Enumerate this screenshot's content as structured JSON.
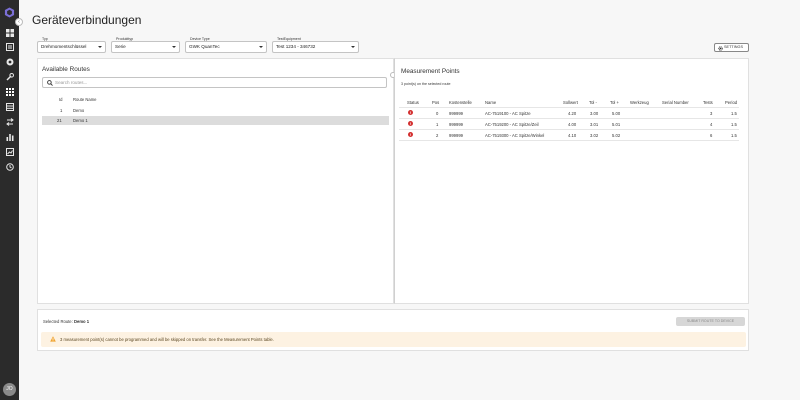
{
  "page": {
    "title": "Geräteverbindungen"
  },
  "user": {
    "initials": "JO"
  },
  "filters": [
    {
      "label": "Typ",
      "value": "Drehmomentschlüssel"
    },
    {
      "label": "Produkttyp",
      "value": "Serie"
    },
    {
      "label": "Device Type",
      "value": "GWK QuanTec"
    },
    {
      "label": "TestEquipment",
      "value": "Test 1234 - 346732"
    }
  ],
  "settings_label": "SETTINGS",
  "routes": {
    "title": "Available Routes",
    "search_placeholder": "Search routes...",
    "columns": [
      "Id",
      "Route Name"
    ],
    "rows": [
      {
        "id": "1",
        "name": "Demo",
        "selected": false
      },
      {
        "id": "21",
        "name": "Demo 1",
        "selected": true
      }
    ]
  },
  "measurement": {
    "title": "Measurement Points",
    "subtitle": "3 point(s) on the selected route",
    "columns": [
      "Status",
      "Pos",
      "Kostenstelle",
      "Name",
      "Sollwert",
      "Tol -",
      "Tol +",
      "Werkzeug",
      "Serial Number",
      "Tests",
      "Period"
    ],
    "rows": [
      {
        "status": "error",
        "pos": "0",
        "kostenstelle": "999999",
        "name": "AC-7519100 - AC Spitze",
        "sollwert": "4.20",
        "tol_minus": "3.00",
        "tol_plus": "5.00",
        "werkzeug": "",
        "serial": "",
        "tests": "3",
        "period": "1.5"
      },
      {
        "status": "error",
        "pos": "1",
        "kostenstelle": "999999",
        "name": "AC-7519200 - AC Spitze/Zeil",
        "sollwert": "4.00",
        "tol_minus": "3.01",
        "tol_plus": "5.01",
        "werkzeug": "",
        "serial": "",
        "tests": "4",
        "period": "1.5"
      },
      {
        "status": "error",
        "pos": "2",
        "kostenstelle": "999999",
        "name": "AC-7519300 - AC Spitze/Winkel",
        "sollwert": "4.10",
        "tol_minus": "3.02",
        "tol_plus": "5.02",
        "werkzeug": "",
        "serial": "",
        "tests": "6",
        "period": "1.5"
      }
    ]
  },
  "footer": {
    "selected_label": "Selected Route:",
    "selected_value": "Demo 1",
    "submit_label": "SUBMIT ROUTE TO DEVICE",
    "warning": "3 measurement point(s) cannot be programmed and will be skipped on transfer. See the Measurement Points table."
  },
  "colors": {
    "sidebar": "#2b2b2b",
    "error": "#d32f2f",
    "warning_bg": "#fdf2e2",
    "selected_row": "#dcdcdc"
  }
}
